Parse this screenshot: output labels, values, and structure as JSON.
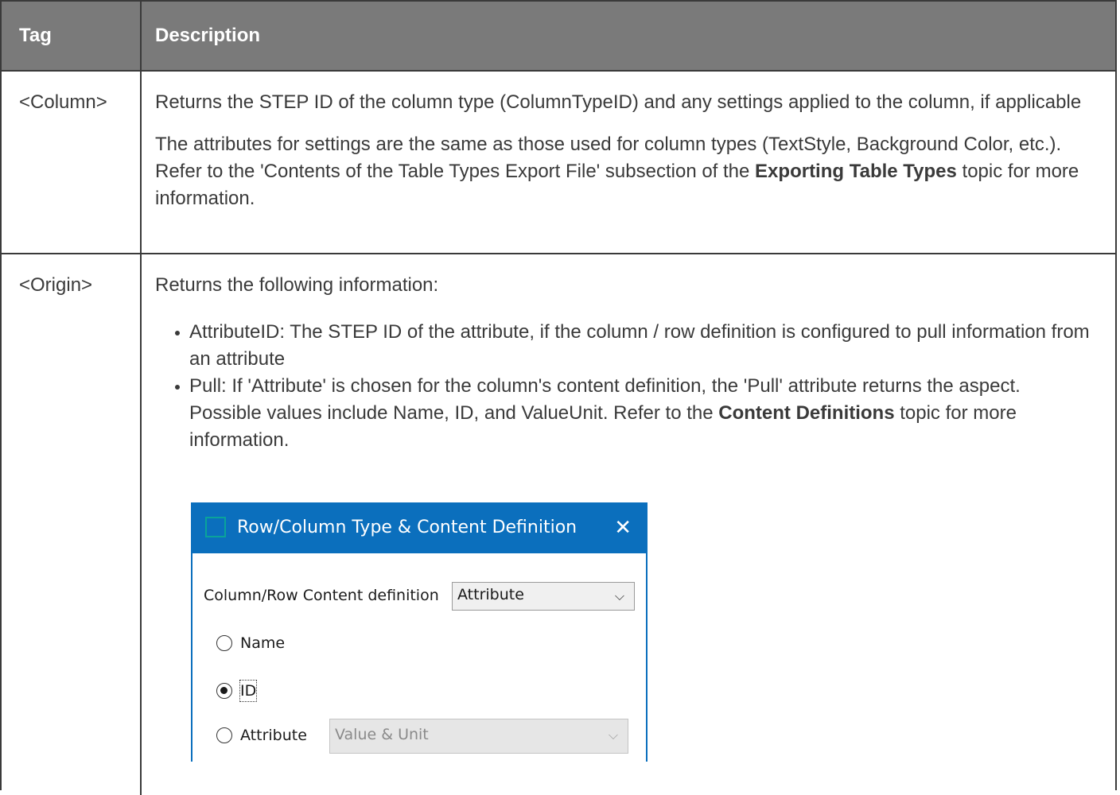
{
  "table": {
    "headers": {
      "tag": "Tag",
      "description": "Description"
    },
    "rows": [
      {
        "tag": "<Column>",
        "para1": "Returns the STEP ID of the column type (ColumnTypeID) and any settings applied to the column, if applicable",
        "para2_pre": "The attributes for settings are the same as those used for column types (TextStyle, Background Color, etc.). Refer to the 'Contents of the Table Types Export File' subsection of the ",
        "para2_bold": "Exporting Table Types",
        "para2_post": " topic for more information."
      },
      {
        "tag": "<Origin>",
        "intro": "Returns the following information:",
        "bullet1": "AttributeID: The STEP ID of the attribute, if the column / row definition is configured to pull information from an attribute",
        "bullet2_pre": "Pull: If 'Attribute' is chosen for the column's content definition, the 'Pull' attribute returns the aspect. Possible values include Name, ID, and ValueUnit. Refer to the ",
        "bullet2_bold": "Content Definitions",
        "bullet2_post": " topic for more information."
      }
    ]
  },
  "dialog": {
    "title": "Row/Column Type & Content Definition",
    "close_glyph": "✕",
    "content_label": "Column/Row Content definition",
    "content_value": "Attribute",
    "radio_name": "Name",
    "radio_id": "ID",
    "radio_attribute": "Attribute",
    "attribute_select_value": "Value & Unit",
    "selected_radio": "ID",
    "chevron_glyph": "⌵"
  },
  "colors": {
    "header_bg": "#7a7a7a",
    "dialog_title_bg": "#0b6fbd"
  }
}
